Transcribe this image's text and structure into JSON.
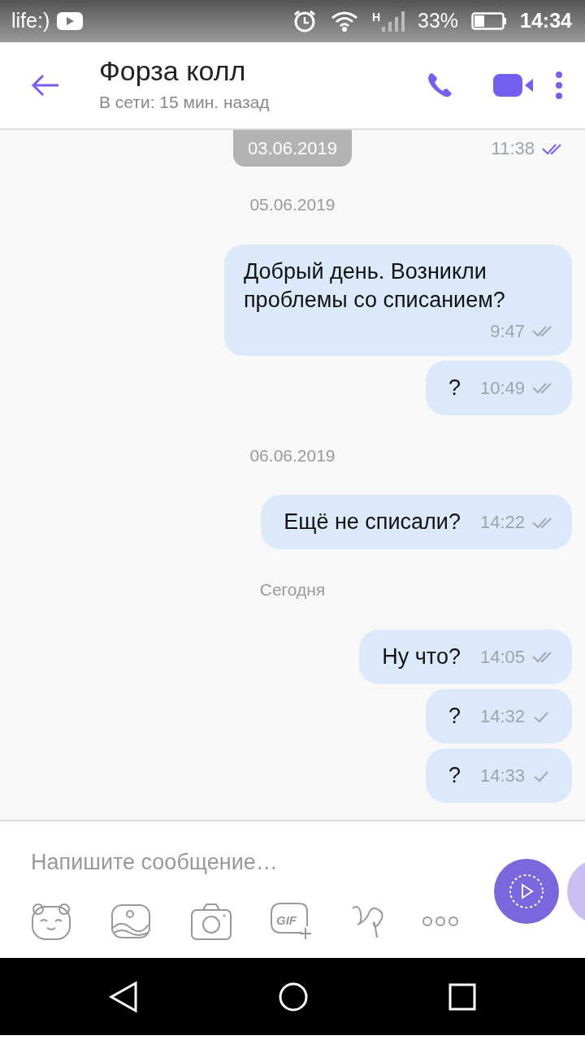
{
  "status_bar": {
    "carrier": "life:)",
    "network": "H",
    "battery": "33%",
    "time": "14:34"
  },
  "header": {
    "title": "Форза колл",
    "subtitle": "В сети: 15 мин. назад"
  },
  "top_strip": {
    "date": "03.06.2019",
    "time": "11:38",
    "delivered": true,
    "read": true
  },
  "chat": [
    {
      "kind": "date",
      "text": "05.06.2019"
    },
    {
      "kind": "message",
      "text": "Добрый день. Возникли проблемы со списанием?",
      "time": "9:47",
      "delivered": true,
      "read": false
    },
    {
      "kind": "message",
      "text": "?",
      "time": "10:49",
      "delivered": true,
      "read": false
    },
    {
      "kind": "date",
      "text": "06.06.2019"
    },
    {
      "kind": "message",
      "text": "Ещё не списали?",
      "time": "14:22",
      "delivered": true,
      "read": false
    },
    {
      "kind": "date",
      "text": "Сегодня"
    },
    {
      "kind": "message",
      "text": "Ну что?",
      "time": "14:05",
      "delivered": true,
      "read": false
    },
    {
      "kind": "message",
      "text": "?",
      "time": "14:32",
      "delivered": false,
      "read": false
    },
    {
      "kind": "message",
      "text": "?",
      "time": "14:33",
      "delivered": false,
      "read": false
    }
  ],
  "composer": {
    "placeholder": "Напишите сообщение…",
    "gif_label": "GIF"
  }
}
